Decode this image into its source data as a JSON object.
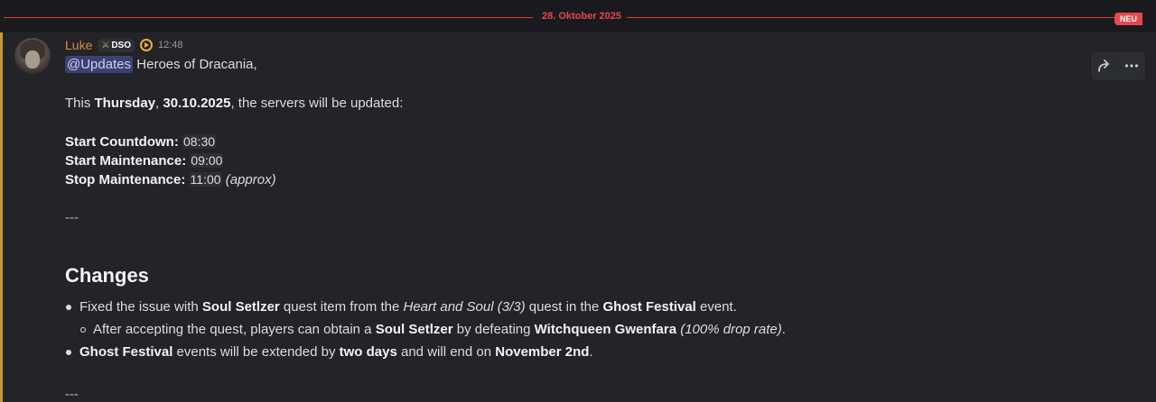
{
  "divider": {
    "date": "28. Oktober 2025",
    "new_badge": "NEU"
  },
  "message": {
    "author": "Luke",
    "tag": "DSO",
    "timestamp": "12:48",
    "mention": "@Updates",
    "greeting": " Heroes of Dracania,",
    "intro": {
      "prefix": "This ",
      "day": "Thursday",
      "sep": ", ",
      "date": "30.10.2025",
      "suffix": ", the servers will be updated:"
    },
    "schedule": [
      {
        "label": "Start Countdown:",
        "time": "08:30",
        "note": ""
      },
      {
        "label": "Start Maintenance:",
        "time": "09:00",
        "note": ""
      },
      {
        "label": "Stop Maintenance:",
        "time": "11:00",
        "note": "(approx)"
      }
    ],
    "separator": "---",
    "changes_heading": "Changes",
    "bullet1": {
      "t1": "Fixed the issue with ",
      "b1": "Soul Setlzer",
      "t2": " quest item from the ",
      "i1": "Heart and Soul (3/3)",
      "t3": " quest in the ",
      "b2": "Ghost Festival",
      "t4": " event."
    },
    "sub_bullet": {
      "t1": "After accepting the quest, players can obtain a ",
      "b1": "Soul Setlzer",
      "t2": " by defeating ",
      "b2": "Witchqueen Gwenfara",
      "t3": " ",
      "i1": "(100% drop rate)",
      "t4": "."
    },
    "bullet2": {
      "b1": "Ghost Festival",
      "t1": " events will be extended by ",
      "b2": "two days",
      "t2": " and will end on ",
      "b3": "November 2nd",
      "t3": "."
    },
    "separator2": "---"
  },
  "hover_actions": {
    "icons": [
      "forward-icon",
      "more-icon"
    ]
  },
  "colors": {
    "accent_red": "#e5484d",
    "username": "#d99237",
    "mention_bg": "#3c4270",
    "mention_bar": "#c49a35"
  }
}
